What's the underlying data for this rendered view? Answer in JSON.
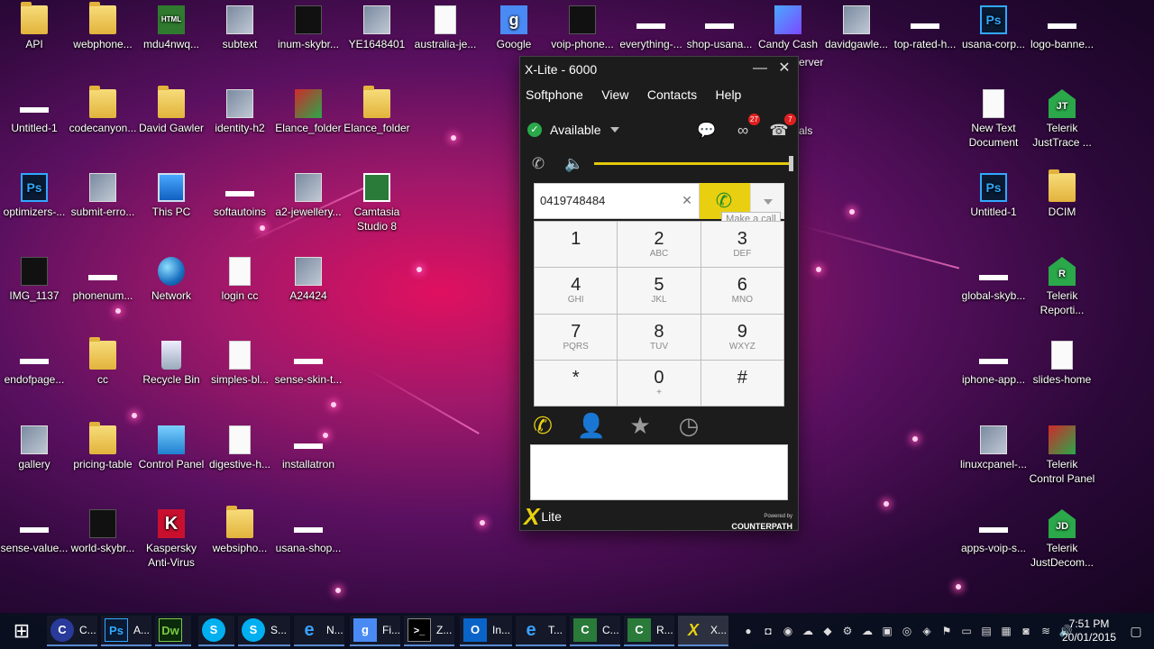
{
  "desktop": {
    "icons": [
      {
        "label": "API"
      },
      {
        "label": "webphone..."
      },
      {
        "label": "mdu4nwq..."
      },
      {
        "label": "subtext"
      },
      {
        "label": "inum-skybr..."
      },
      {
        "label": "YE1648401"
      },
      {
        "label": "australia-je..."
      },
      {
        "label": "Google"
      },
      {
        "label": "voip-phone..."
      },
      {
        "label": "everything-..."
      },
      {
        "label": "shop-usana..."
      },
      {
        "label": "Candy Cash"
      },
      {
        "label": "davidgawle..."
      },
      {
        "label": "top-rated-h..."
      },
      {
        "label": "usana-corp..."
      },
      {
        "label": "logo-banne..."
      },
      {
        "label": "Untitled-1"
      },
      {
        "label": "codecanyon..."
      },
      {
        "label": "David Gawler"
      },
      {
        "label": "identity-h2"
      },
      {
        "label": "Elance_folder"
      },
      {
        "label": "Elance_folder"
      },
      {
        "label": "optimizers-..."
      },
      {
        "label": "submit-erro..."
      },
      {
        "label": "This PC"
      },
      {
        "label": "softautoins"
      },
      {
        "label": "a2-jewellery..."
      },
      {
        "label": "Camtasia Studio 8"
      },
      {
        "label": "IMG_1137"
      },
      {
        "label": "phonenum..."
      },
      {
        "label": "Network"
      },
      {
        "label": "login cc"
      },
      {
        "label": "A24424"
      },
      {
        "label": "endofpage..."
      },
      {
        "label": "cc"
      },
      {
        "label": "Recycle Bin"
      },
      {
        "label": "simples-bl..."
      },
      {
        "label": "sense-skin-t..."
      },
      {
        "label": "gallery"
      },
      {
        "label": "pricing-table"
      },
      {
        "label": "Control Panel"
      },
      {
        "label": "digestive-h..."
      },
      {
        "label": "installatron"
      },
      {
        "label": "sense-value..."
      },
      {
        "label": "world-skybr..."
      },
      {
        "label": "Kaspersky Anti-Virus"
      },
      {
        "label": "websipho..."
      },
      {
        "label": "usana-shop..."
      },
      {
        "label": "New Text Document"
      },
      {
        "label": "Telerik JustTrace ..."
      },
      {
        "label": "Untitled-1"
      },
      {
        "label": "DCIM"
      },
      {
        "label": "global-skyb..."
      },
      {
        "label": "Telerik Reporti..."
      },
      {
        "label": "iphone-app..."
      },
      {
        "label": "slides-home"
      },
      {
        "label": "linuxcpanel-..."
      },
      {
        "label": "Telerik Control Panel"
      },
      {
        "label": "apps-voip-s..."
      },
      {
        "label": "Telerik JustDecom..."
      }
    ],
    "behind_window_fragments": [
      "erver",
      "als"
    ]
  },
  "xlite": {
    "title": "X-Lite - 6000",
    "minimize": "—",
    "close": "✕",
    "menu": [
      "Softphone",
      "View",
      "Contacts",
      "Help"
    ],
    "status": "Available",
    "voicemail_count": "27",
    "missed_count": "7",
    "dial_value": "0419748484",
    "tooltip": "Make a call",
    "keys": [
      {
        "digit": "1",
        "letters": ""
      },
      {
        "digit": "2",
        "letters": "ABC"
      },
      {
        "digit": "3",
        "letters": "DEF"
      },
      {
        "digit": "4",
        "letters": "GHI"
      },
      {
        "digit": "5",
        "letters": "JKL"
      },
      {
        "digit": "6",
        "letters": "MNO"
      },
      {
        "digit": "7",
        "letters": "PQRS"
      },
      {
        "digit": "8",
        "letters": "TUV"
      },
      {
        "digit": "9",
        "letters": "WXYZ"
      },
      {
        "digit": "*",
        "letters": ""
      },
      {
        "digit": "0",
        "letters": "+"
      },
      {
        "digit": "#",
        "letters": ""
      }
    ],
    "volume_level": 1.0,
    "logo_text": "Lite",
    "logo_mark": "X",
    "powered_by": "Powered by",
    "brand": "COUNTERPATH",
    "colors": {
      "accent": "#e8d010",
      "call_green": "#1a8a2a",
      "available": "#2aa84a"
    }
  },
  "taskbar": {
    "items": [
      {
        "icon": "C",
        "label": "C..."
      },
      {
        "icon": "Ps",
        "label": "A..."
      },
      {
        "icon": "Dw",
        "label": ""
      },
      {
        "icon": "S",
        "label": ""
      },
      {
        "icon": "S",
        "label": "S..."
      },
      {
        "icon": "e",
        "label": "N..."
      },
      {
        "icon": "g",
        "label": "Fi..."
      },
      {
        "icon": ">_",
        "label": "Z..."
      },
      {
        "icon": "O",
        "label": "In..."
      },
      {
        "icon": "e",
        "label": "T..."
      },
      {
        "icon": "C",
        "label": "C..."
      },
      {
        "icon": "C",
        "label": "R..."
      },
      {
        "icon": "X",
        "label": "X..."
      }
    ],
    "time": "7:51 PM",
    "date": "20/01/2015"
  }
}
